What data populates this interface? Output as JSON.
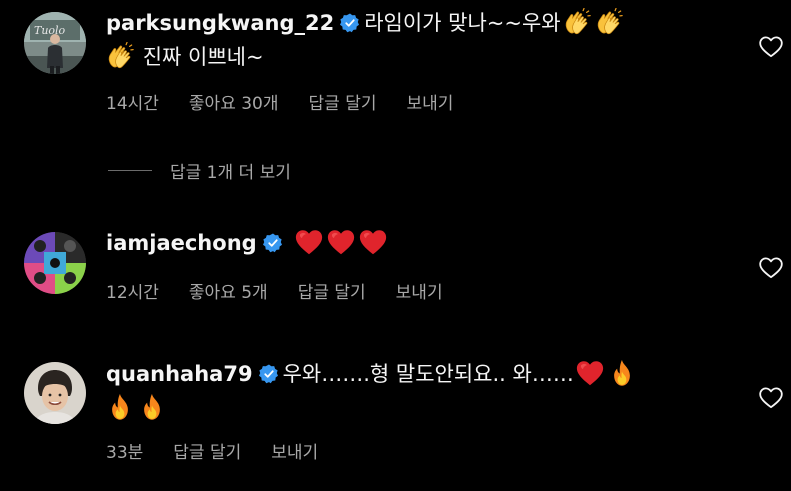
{
  "comments": [
    {
      "username": "parksungkwang_22",
      "text": "라임이가 맞나~~우와",
      "text2": "진짜 이쁘네~",
      "time": "14시간",
      "likes": "좋아요 30개",
      "reply": "답글 달기",
      "send": "보내기"
    },
    {
      "username": "iamjaechong",
      "time": "12시간",
      "likes": "좋아요 5개",
      "reply": "답글 달기",
      "send": "보내기"
    },
    {
      "username": "quanhaha79",
      "text": "우와…….형 말도안되요.. 와……",
      "time": "33분",
      "reply": "답글 달기",
      "send": "보내기"
    }
  ],
  "view_replies": "답글 1개 더 보기",
  "colors": {
    "background": "#000000",
    "secondary_text": "#a8a8a8",
    "verified": "#3797f0",
    "heart_red": "#e0242c"
  },
  "icons": [
    "verified-badge-icon",
    "clap-emoji",
    "red-heart-emoji",
    "fire-emoji",
    "heart-outline-icon"
  ]
}
